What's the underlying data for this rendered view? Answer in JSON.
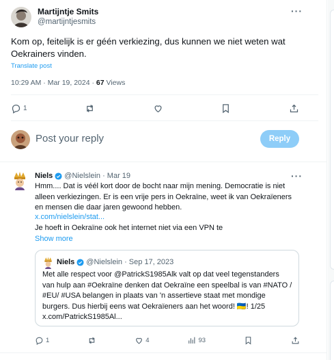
{
  "tweet": {
    "author_name": "Martijntje Smits",
    "author_handle": "@martijntjesmits",
    "text": "Kom op, feitelijk is er géén verkiezing, dus kunnen we niet weten wat Oekrainers vinden.",
    "translate_label": "Translate post",
    "timestamp": "10:29 AM · Mar 19, 2024 · ",
    "views_count": "67",
    "views_label": " Views",
    "reply_count": "1"
  },
  "composer": {
    "placeholder": "Post your reply",
    "button_label": "Reply"
  },
  "reply": {
    "name": "Niels",
    "handle": "@Nielslein · Mar 19",
    "text": "Hmm.... Dat is véél kort door de bocht naar mijn mening. Democratie is niet alleen verkiezingen. Er is een vrije pers in Oekraïne, weet ik van Oekraïeners en mensen die daar jaren gewoond hebben.",
    "link": "x.com/nielslein/stat...",
    "text2": "Je hoeft in Oekraïne ook het internet niet via een VPN te",
    "show_more": "Show more",
    "reply_count": "1",
    "like_count": "4",
    "view_count": "93"
  },
  "quote": {
    "name": "Niels",
    "handle": "@Nielslein · Sep 17, 2023",
    "text": "Met alle respect voor @PatrickS1985Alk valt op dat veel tegenstanders van hulp aan #Oekraïne denken dat Oekraïne een speelbal is van #NATO / #EU/ #USA  belangen in plaats van 'n assertieve staat met mondige burgers. Dus hierbij eens wat Oekraïeners aan het woord! 🇺🇦! 1/25 x.com/PatrickS1985Al..."
  },
  "colors": {
    "accent": "#1d9bf0",
    "reply_button_disabled": "#8ecdf8",
    "secondary_text": "#536471"
  },
  "icons": [
    "more-icon",
    "reply-icon",
    "retweet-icon",
    "like-icon",
    "bookmark-icon",
    "share-icon",
    "verified-icon",
    "views-icon"
  ]
}
